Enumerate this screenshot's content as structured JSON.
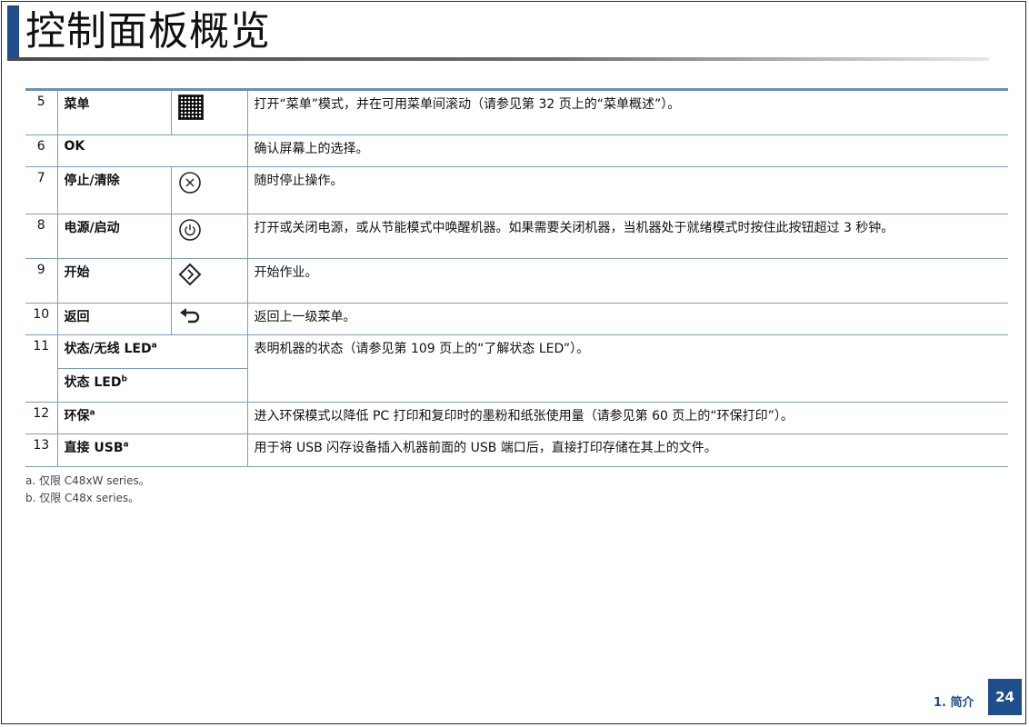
{
  "page": {
    "title": "控制面板概览",
    "section": "1. 简介",
    "page_number": "24",
    "accent_color": "#1f4e8c"
  },
  "rows": [
    {
      "num": "5",
      "name": "菜单",
      "icon": "menu-qr-icon",
      "desc": "打开“菜单”模式，并在可用菜单间滚动（请参见第 32 页上的“菜单概述”）。"
    },
    {
      "num": "6",
      "name": "OK",
      "desc": "确认屏幕上的选择。"
    },
    {
      "num": "7",
      "name": "停止/清除",
      "icon": "stop-clear-icon",
      "desc": "随时停止操作。"
    },
    {
      "num": "8",
      "name": "电源/启动",
      "icon": "power-icon",
      "desc": "打开或关闭电源，或从节能模式中唤醒机器。如果需要关闭机器，当机器处于就绪模式时按住此按钮超过 3 秒钟。"
    },
    {
      "num": "9",
      "name": "开始",
      "icon": "start-diamond-icon",
      "desc": "开始作业。"
    },
    {
      "num": "10",
      "name": "返回",
      "icon": "back-arrow-icon",
      "desc": "返回上一级菜单。"
    },
    {
      "num": "11",
      "name": "状态/无线 LED",
      "name_sup": "a",
      "name2": "状态 LED",
      "name2_sup": "b",
      "desc": "表明机器的状态（请参见第 109 页上的“了解状态 LED”）。"
    },
    {
      "num": "12",
      "name": "环保",
      "name_sup": "a",
      "desc": "进入环保模式以降低 PC 打印和复印时的墨粉和纸张使用量（请参见第 60 页上的“环保打印”）。"
    },
    {
      "num": "13",
      "name": "直接 USB",
      "name_sup": "a",
      "desc": "用于将 USB 闪存设备插入机器前面的 USB 端口后，直接打印存储在其上的文件。"
    }
  ],
  "footnotes": [
    "a. 仅限 C48xW series。",
    "b. 仅限 C48x series。"
  ]
}
